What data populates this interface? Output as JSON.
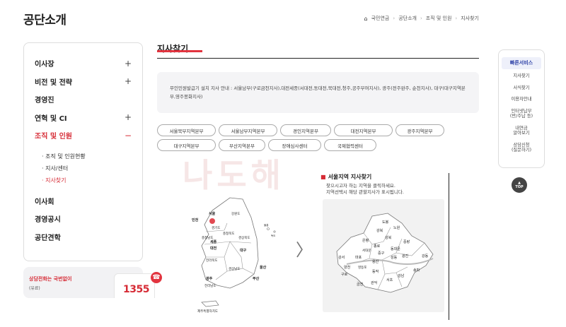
{
  "header": {
    "page_title": "공단소개",
    "breadcrumb": [
      "국민연금",
      "공단소개",
      "조직 및 인원",
      "지사찾기"
    ]
  },
  "sidebar": {
    "items": [
      {
        "label": "이사장",
        "toggle": "+"
      },
      {
        "label": "비전 및 전략",
        "toggle": "+"
      },
      {
        "label": "경영진",
        "toggle": ""
      },
      {
        "label": "연혁 및 CI",
        "toggle": "+"
      },
      {
        "label": "조직 및 인원",
        "toggle": "−"
      },
      {
        "label": "이사회",
        "toggle": ""
      },
      {
        "label": "경영공시",
        "toggle": ""
      },
      {
        "label": "공단견학",
        "toggle": ""
      }
    ],
    "sub_items": [
      "· 조직 및 인원현황",
      "· 지사/센터",
      "· 지사찾기"
    ]
  },
  "call": {
    "label": "상담전화는 국번없이",
    "sub": "(유료)",
    "number": "1355"
  },
  "main": {
    "section_title": "지사찾기",
    "info_text": "무인민원발급기 설치 지사 안내 : 서울남부(구로금천지사),대전세종(서대전,동대전,북대전,청주,공주부여지사), 광주(전주완주, 순천지사), 대구(대구지역본부,영주봉화지사)",
    "regions": [
      "서울북부지역본부",
      "서울남부지역본부",
      "경인지역본부",
      "대전지역본부",
      "광주지역본부",
      "대구지역본부",
      "부산지역본부",
      "장애심사센터",
      "국제협력센터"
    ],
    "watermark": "나도해",
    "arrow": "〉",
    "seoul_title": "서울지역 지사찾기",
    "seoul_desc_1": "찾으시고자 하는 지역을 클릭하세요.",
    "seoul_desc_2": "지역선택시 해당 관할지사가 표시됩니다."
  },
  "map_labels": {
    "korea": [
      "서울",
      "인천",
      "강원도",
      "경기도",
      "충청북도",
      "세종",
      "대전",
      "충청남도",
      "대구",
      "경상북도",
      "전라북도",
      "광주",
      "울산",
      "부산",
      "경상남도",
      "전라남도",
      "제주특별자치도",
      "울릉",
      "독도"
    ],
    "seoul": [
      "도봉",
      "강북",
      "노원",
      "은평",
      "성북",
      "중랑",
      "종로",
      "동대문",
      "서대문",
      "중구",
      "광진",
      "강서",
      "마포",
      "용산",
      "성동",
      "강동",
      "양천",
      "영등포",
      "동작",
      "송파",
      "구로",
      "금천",
      "관악",
      "서초",
      "강남"
    ]
  },
  "quick": {
    "title": "빠른서비스",
    "items": [
      "지사찾기",
      "서식찾기",
      "이용자안내",
      "인터넷납부\n(반/주납 등)",
      "내연금\n알아보기",
      "상담신청\n(질문하기)"
    ]
  },
  "top_button": {
    "arrow": "▲",
    "label": "TOP"
  },
  "colors": {
    "accent": "#d62b35",
    "quick_title": "#2b3fa6",
    "panel": "#f2f2f2"
  }
}
